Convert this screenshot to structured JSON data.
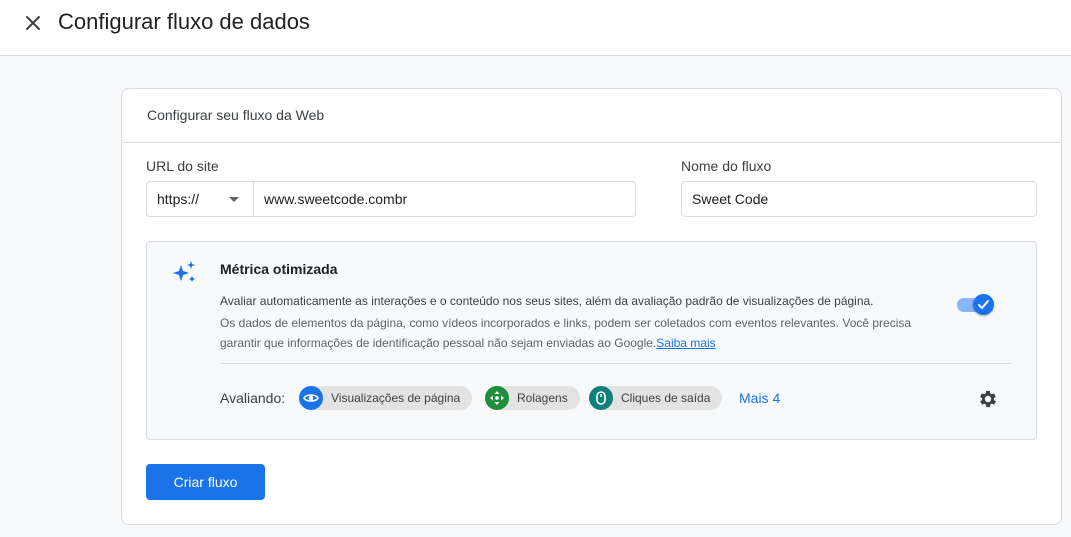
{
  "header": {
    "title": "Configurar fluxo de dados",
    "close_icon": "close-icon"
  },
  "card": {
    "heading": "Configurar seu fluxo da Web",
    "url_label": "URL do site",
    "protocol_value": "https://",
    "url_value": "www.sweetcode.combr",
    "name_label": "Nome do fluxo",
    "name_value": "Sweet Code"
  },
  "metrics": {
    "icon": "sparkle-icon",
    "title": "Métrica otimizada",
    "description_bold": "Avaliar automaticamente as interações e o conteúdo nos seus sites, além da avaliação padrão de visualizações de página.",
    "description": "Os dados de elementos da página, como vídeos incorporados e links, podem ser coletados com eventos relevantes. Você precisa garantir que informações de identificação pessoal não sejam enviadas ao Google.",
    "learn_more": "Saiba mais",
    "toggle_on": true,
    "evaluating_label": "Avaliando:",
    "chips": [
      {
        "label": "Visualizações de página",
        "icon": "eye-icon",
        "color": "#1a73e8"
      },
      {
        "label": "Rolagens",
        "icon": "move-arrows-icon",
        "color": "#1e8e3e"
      },
      {
        "label": "Cliques de saída",
        "icon": "mouse-icon",
        "color": "#12807a"
      }
    ],
    "more_link": "Mais 4",
    "settings_icon": "gear-icon"
  },
  "actions": {
    "create_label": "Criar fluxo"
  },
  "colors": {
    "accent": "#1a73e8",
    "toggle_track": "#8ab4f8",
    "border": "#dadce0"
  }
}
